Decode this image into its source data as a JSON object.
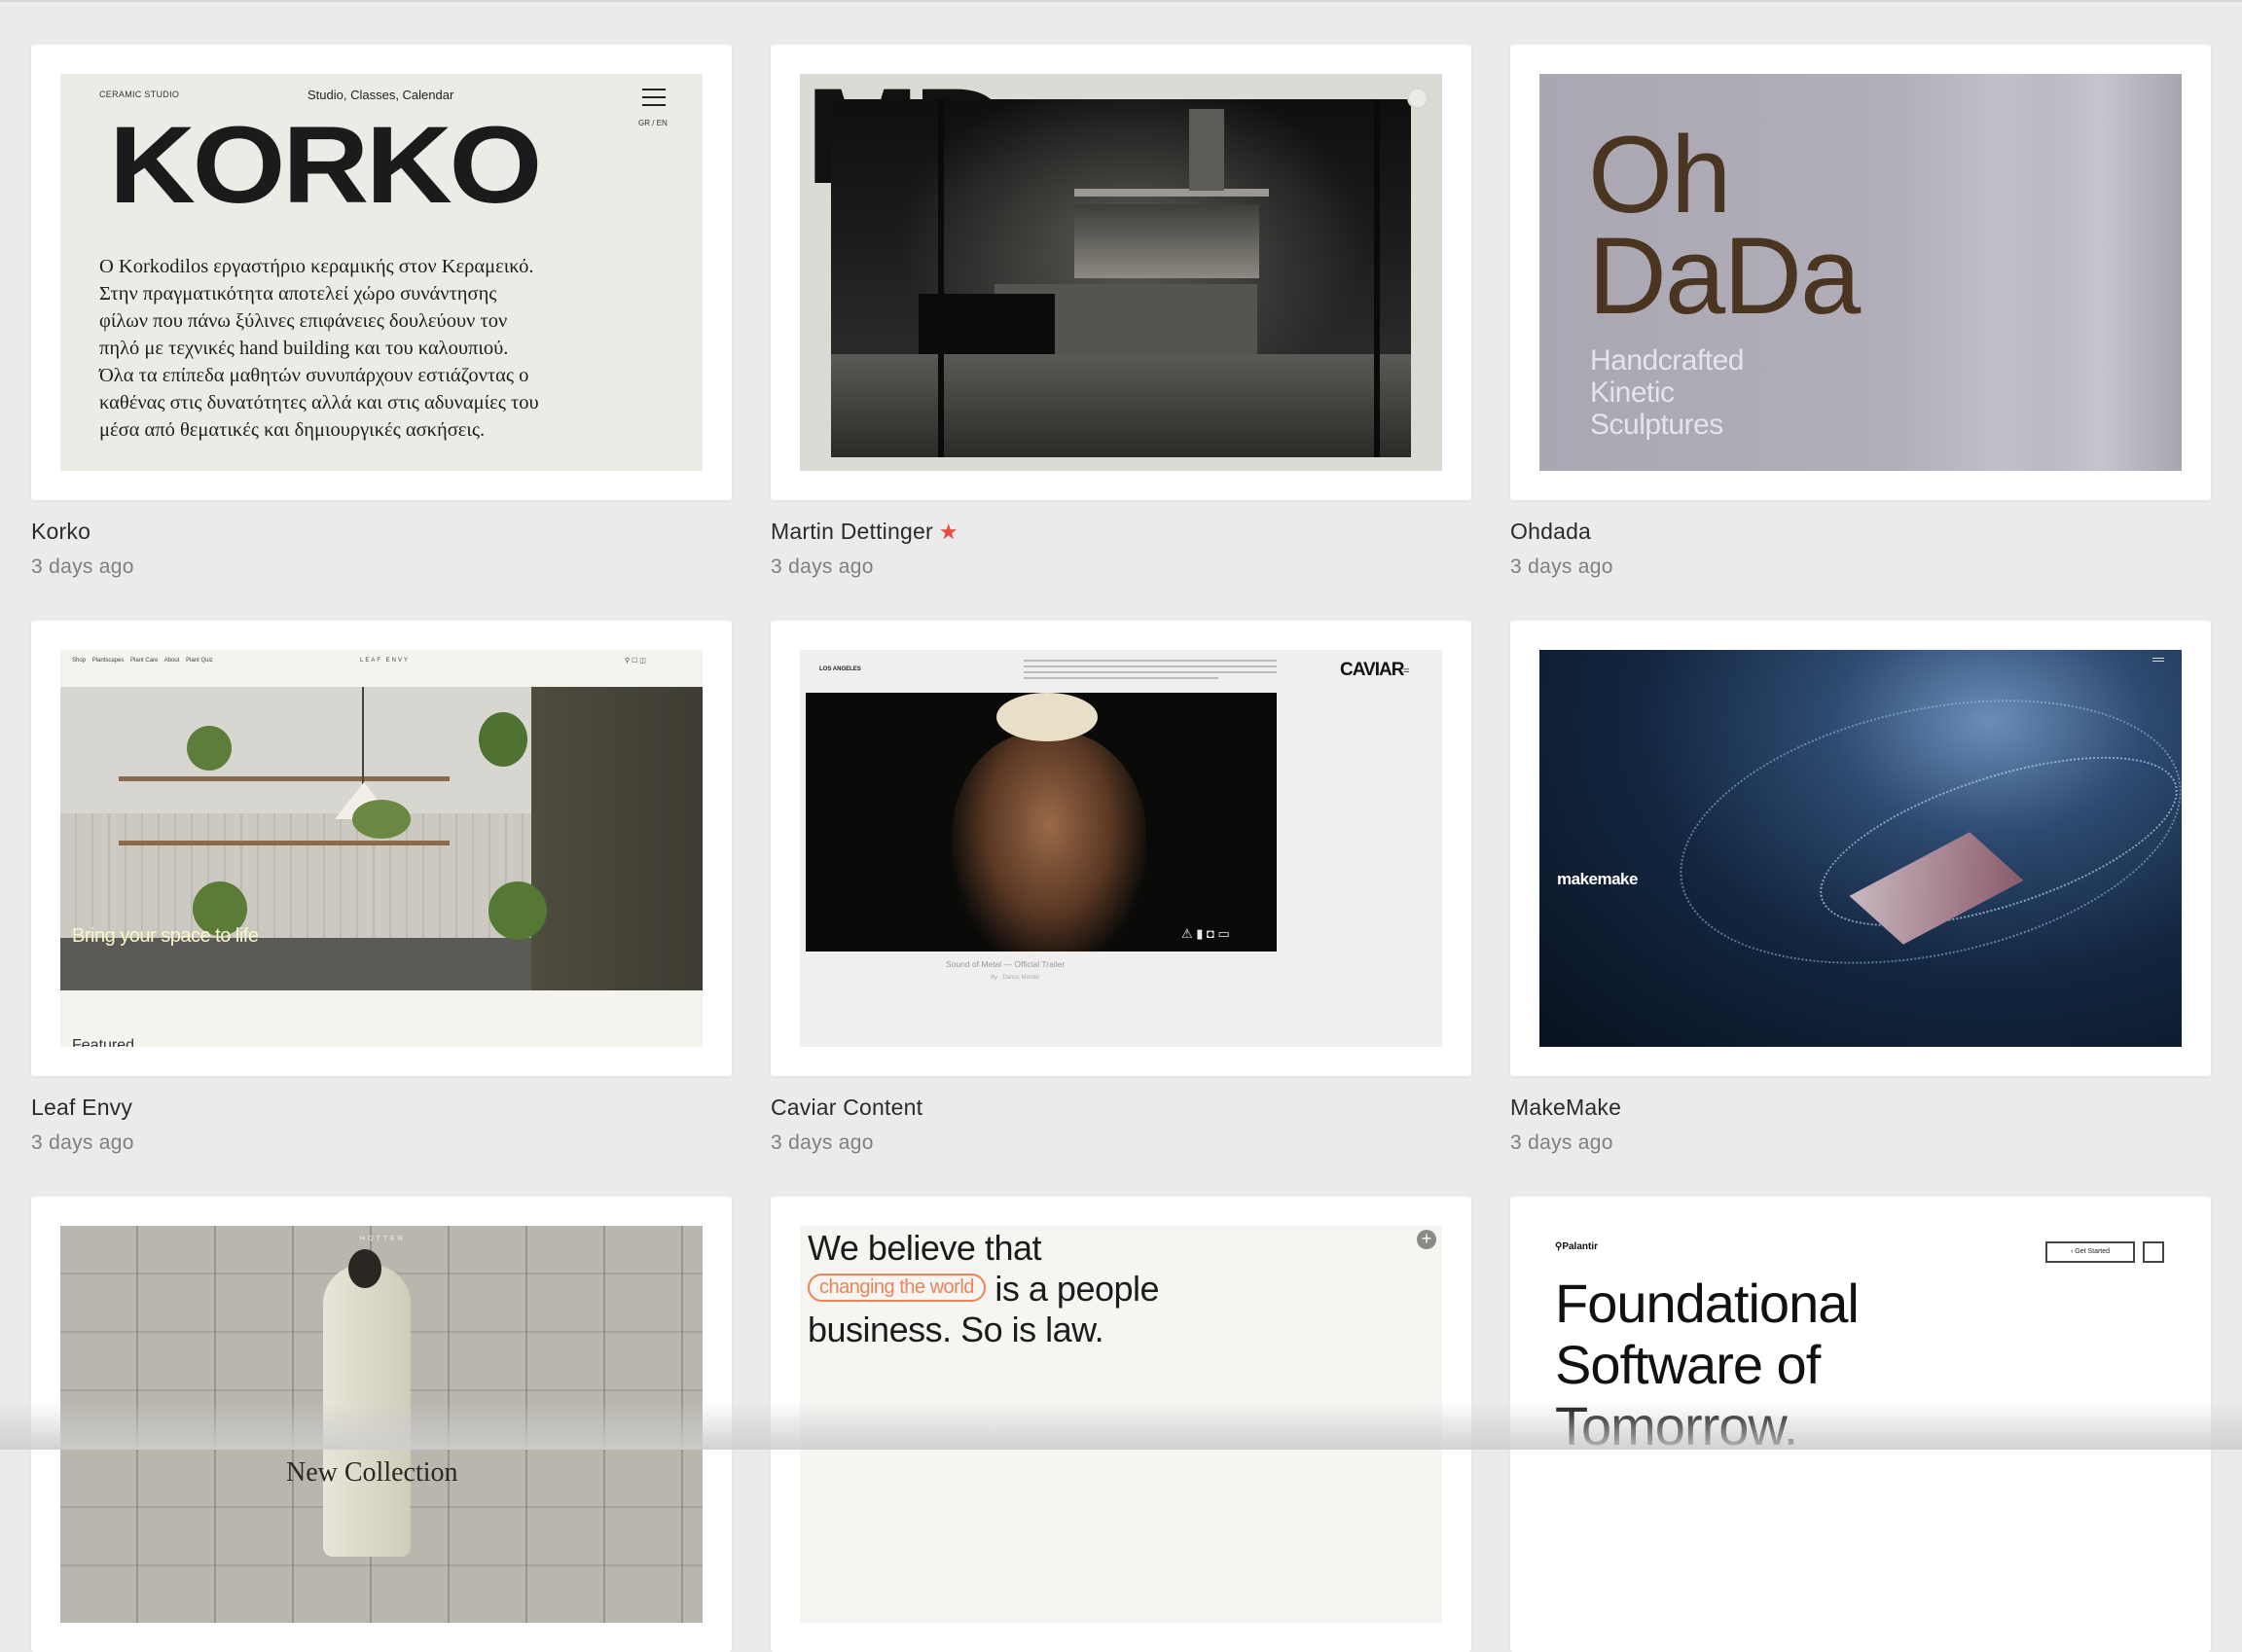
{
  "colors": {
    "background": "#ebebeb",
    "card": "#ffffff",
    "accent_star": "#e84b3c",
    "muted_text": "#7f7f7f"
  },
  "items": [
    {
      "title": "Korko",
      "time": "3 days ago",
      "preview": {
        "brand_small": "CERAMIC STUDIO",
        "nav": "Studio, Classes, Calendar",
        "lang": "GR / EN",
        "logo": "KORKO",
        "body_lines": [
          "Ο Korkodilos εργαστήριο κεραμικής στον Κεραμεικό.",
          "Στην πραγματικότητα αποτελεί χώρο συνάντησης",
          "φίλων που πάνω ξύλινες επιφάνειες δουλεύουν τον",
          "πηλό με τεχνικές hand building και του καλουπιού.",
          "Όλα τα επίπεδα μαθητών συνυπάρχουν εστιάζοντας ο",
          "καθένας στις δυνατότητες αλλά και στις αδυναμίες του",
          "μέσα από θεματικές και δημιουργικές ασκήσεις."
        ]
      }
    },
    {
      "title": "Martin Dettinger",
      "time": "3 days ago",
      "starred": true,
      "preview": {
        "corner_letters": "MD"
      }
    },
    {
      "title": "Ohdada",
      "time": "3 days ago",
      "preview": {
        "logo_line1": "Oh",
        "logo_line2": "DaDa",
        "sub1": "Handcrafted",
        "sub2": "Kinetic",
        "sub3": "Sculptures"
      }
    },
    {
      "title": "Leaf Envy",
      "time": "3 days ago",
      "preview": {
        "brand": "LEAF ENVY",
        "nav": [
          "Shop",
          "Plantscapes",
          "Plant Care",
          "About",
          "Plant Quiz"
        ],
        "headline": "Bring your space to life",
        "cut_text": "Featured"
      }
    },
    {
      "title": "Caviar Content",
      "time": "3 days ago",
      "preview": {
        "location": "LOS ANGELES",
        "logo": "CAVIAR",
        "caption": "Sound of Metal — Official Trailer",
        "credit": "By · Darius Marder"
      }
    },
    {
      "title": "MakeMake",
      "time": "3 days ago",
      "preview": {
        "overlay": "makemake"
      }
    },
    {
      "title": "",
      "time": "",
      "preview": {
        "brand": "HOTTER",
        "headline": "New Collection"
      }
    },
    {
      "title": "",
      "time": "",
      "preview": {
        "line1": "We believe that",
        "pill": "changing the world",
        "line2_rest": "is a people",
        "line3": "business. So is law."
      }
    },
    {
      "title": "",
      "time": "",
      "preview": {
        "brand": "Palantir",
        "cta": "Get Started",
        "line1": "Foundational",
        "line2": "Software of",
        "line3": "Tomorrow."
      }
    }
  ]
}
